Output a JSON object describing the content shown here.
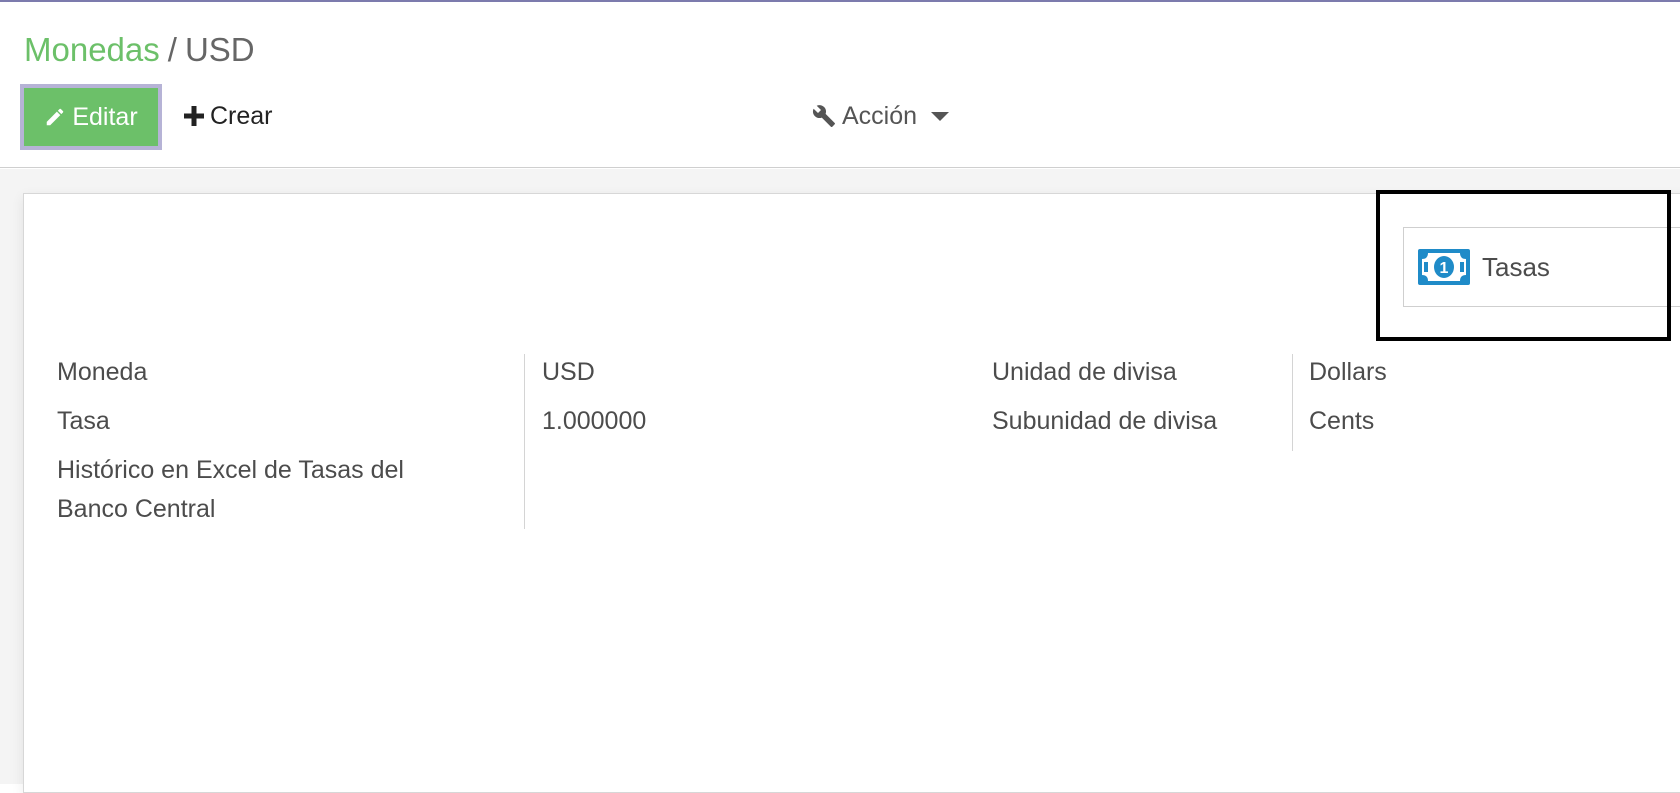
{
  "breadcrumb": {
    "parent": "Monedas",
    "separator": "/",
    "current": "USD"
  },
  "toolbar": {
    "edit_label": "Editar",
    "create_label": "Crear",
    "action_label": "Acción"
  },
  "smart_button": {
    "icon": "money-bill-icon",
    "label": "Tasas"
  },
  "form": {
    "left": [
      {
        "label": "Moneda",
        "value": "USD"
      },
      {
        "label": "Tasa",
        "value": "1.000000"
      },
      {
        "label_line1": "Histórico en Excel de Tasas del",
        "label_line2": "Banco Central",
        "value": ""
      }
    ],
    "right": [
      {
        "label": "Unidad de divisa",
        "value": "Dollars"
      },
      {
        "label": "Subunidad de divisa",
        "value": "Cents"
      }
    ]
  },
  "colors": {
    "brand_green": "#6cc069",
    "top_border": "#7c7bad",
    "icon_blue": "#1f8bc8",
    "highlight": "#000000"
  }
}
